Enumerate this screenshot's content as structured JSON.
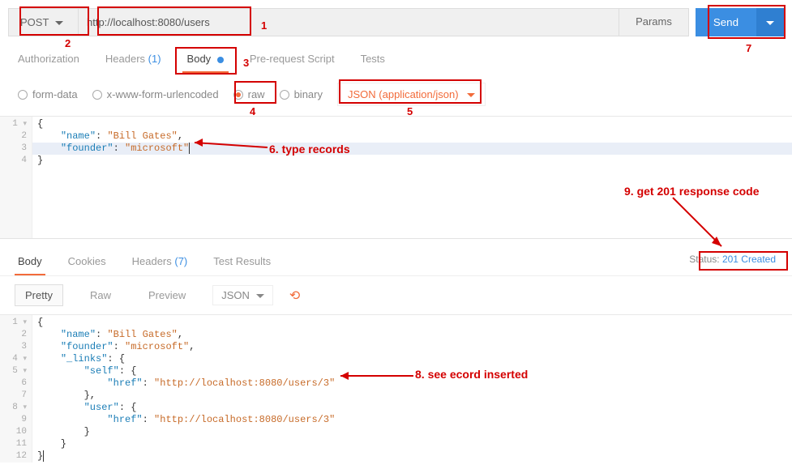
{
  "request": {
    "method": "POST",
    "url": "http://localhost:8080/users",
    "params_label": "Params",
    "send_label": "Send"
  },
  "req_tabs": {
    "authorization": "Authorization",
    "headers_label": "Headers",
    "headers_count": "(1)",
    "body": "Body",
    "prerequest": "Pre-request Script",
    "tests": "Tests"
  },
  "body_opts": {
    "formdata": "form-data",
    "urlencoded": "x-www-form-urlencoded",
    "raw": "raw",
    "binary": "binary",
    "content_type": "JSON (application/json)"
  },
  "req_editor": {
    "lines": [
      "1",
      "2",
      "3",
      "4"
    ],
    "l1": "{",
    "l2_k": "\"name\"",
    "l2_v": "\"Bill Gates\"",
    "l3_k": "\"founder\"",
    "l3_v": "\"microsoft\"",
    "l4": "}"
  },
  "resp_tabs": {
    "body": "Body",
    "cookies": "Cookies",
    "headers_label": "Headers",
    "headers_count": "(7)",
    "testresults": "Test Results"
  },
  "status": {
    "label": "Status:",
    "value": "201 Created"
  },
  "view": {
    "pretty": "Pretty",
    "raw": "Raw",
    "preview": "Preview",
    "format": "JSON"
  },
  "resp_editor": {
    "gutters": [
      "1",
      "2",
      "3",
      "4",
      "5",
      "6",
      "7",
      "8",
      "9",
      "10",
      "11",
      "12"
    ],
    "k_name": "\"name\"",
    "v_name": "\"Bill Gates\"",
    "k_founder": "\"founder\"",
    "v_founder": "\"microsoft\"",
    "k_links": "\"_links\"",
    "k_self": "\"self\"",
    "k_href": "\"href\"",
    "v_href": "\"http://localhost:8080/users/3\"",
    "k_user": "\"user\""
  },
  "annotations": {
    "a1": "1",
    "a2": "2",
    "a3": "3",
    "a4": "4",
    "a5": "5",
    "a6": "6. type records",
    "a7": "7",
    "a8": "8. see ecord inserted",
    "a9": "9. get 201 response code"
  }
}
